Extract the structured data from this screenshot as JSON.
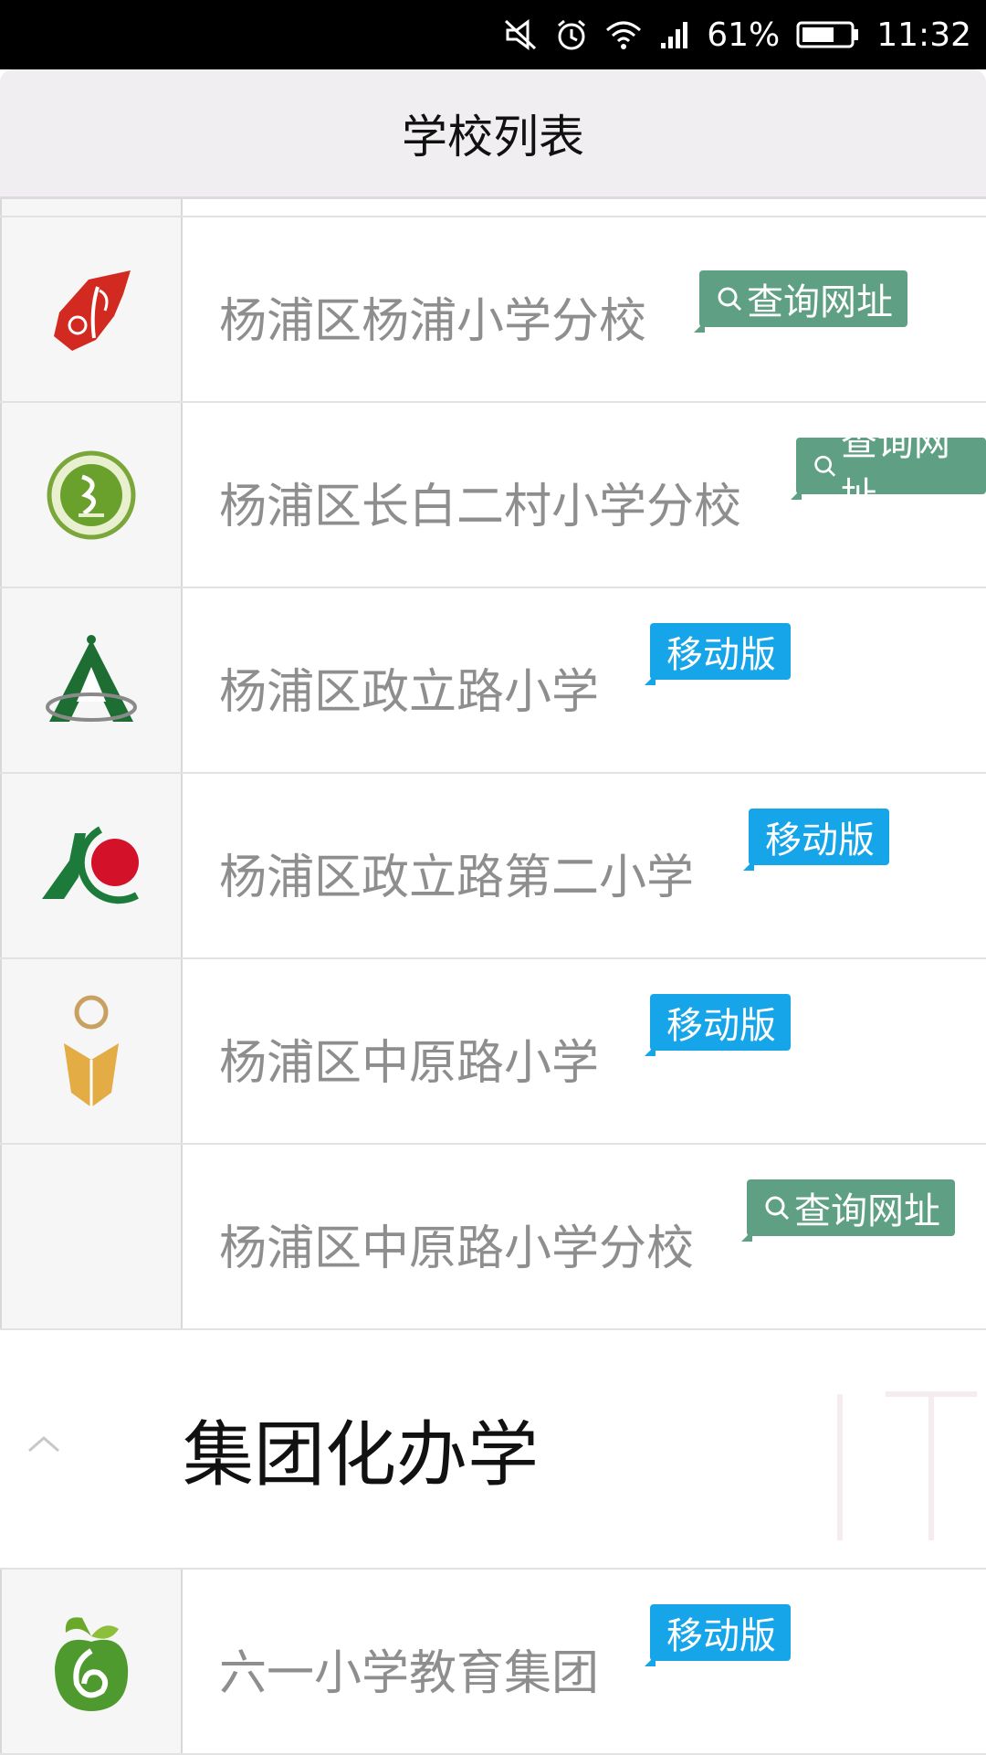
{
  "status_bar": {
    "battery": "61%",
    "time": "11:32",
    "icons": [
      "mute-icon",
      "alarm-icon",
      "wifi-icon",
      "signal-icon",
      "battery-icon"
    ]
  },
  "header": {
    "title": "学校列表"
  },
  "tags": {
    "query": "查询网址",
    "mobile": "移动版"
  },
  "schools": [
    {
      "name": "杨浦区杨浦小学分校",
      "tag": "查询网址",
      "logo": "red-quill-logo"
    },
    {
      "name": "杨浦区长白二村小学分校",
      "tag": "查询网址",
      "logo": "green-seal-logo"
    },
    {
      "name": "杨浦区政立路小学",
      "tag": "移动版",
      "logo": "green-a-logo"
    },
    {
      "name": "杨浦区政立路第二小学",
      "tag": "移动版",
      "logo": "green-red-orb-logo"
    },
    {
      "name": "杨浦区中原路小学",
      "tag": "移动版",
      "logo": "gold-figure-logo"
    },
    {
      "name": "杨浦区中原路小学分校",
      "tag": "查询网址",
      "logo": ""
    }
  ],
  "group": {
    "title": "集团化办学"
  },
  "group_schools": [
    {
      "name": "六一小学教育集团",
      "tag": "移动版",
      "logo": "green-apple-logo"
    }
  ],
  "colors": {
    "query_tag": "#5fa084",
    "mobile_tag": "#17a5ea",
    "school_name": "#8e8e8e",
    "header_bg": "#f0eef0"
  }
}
